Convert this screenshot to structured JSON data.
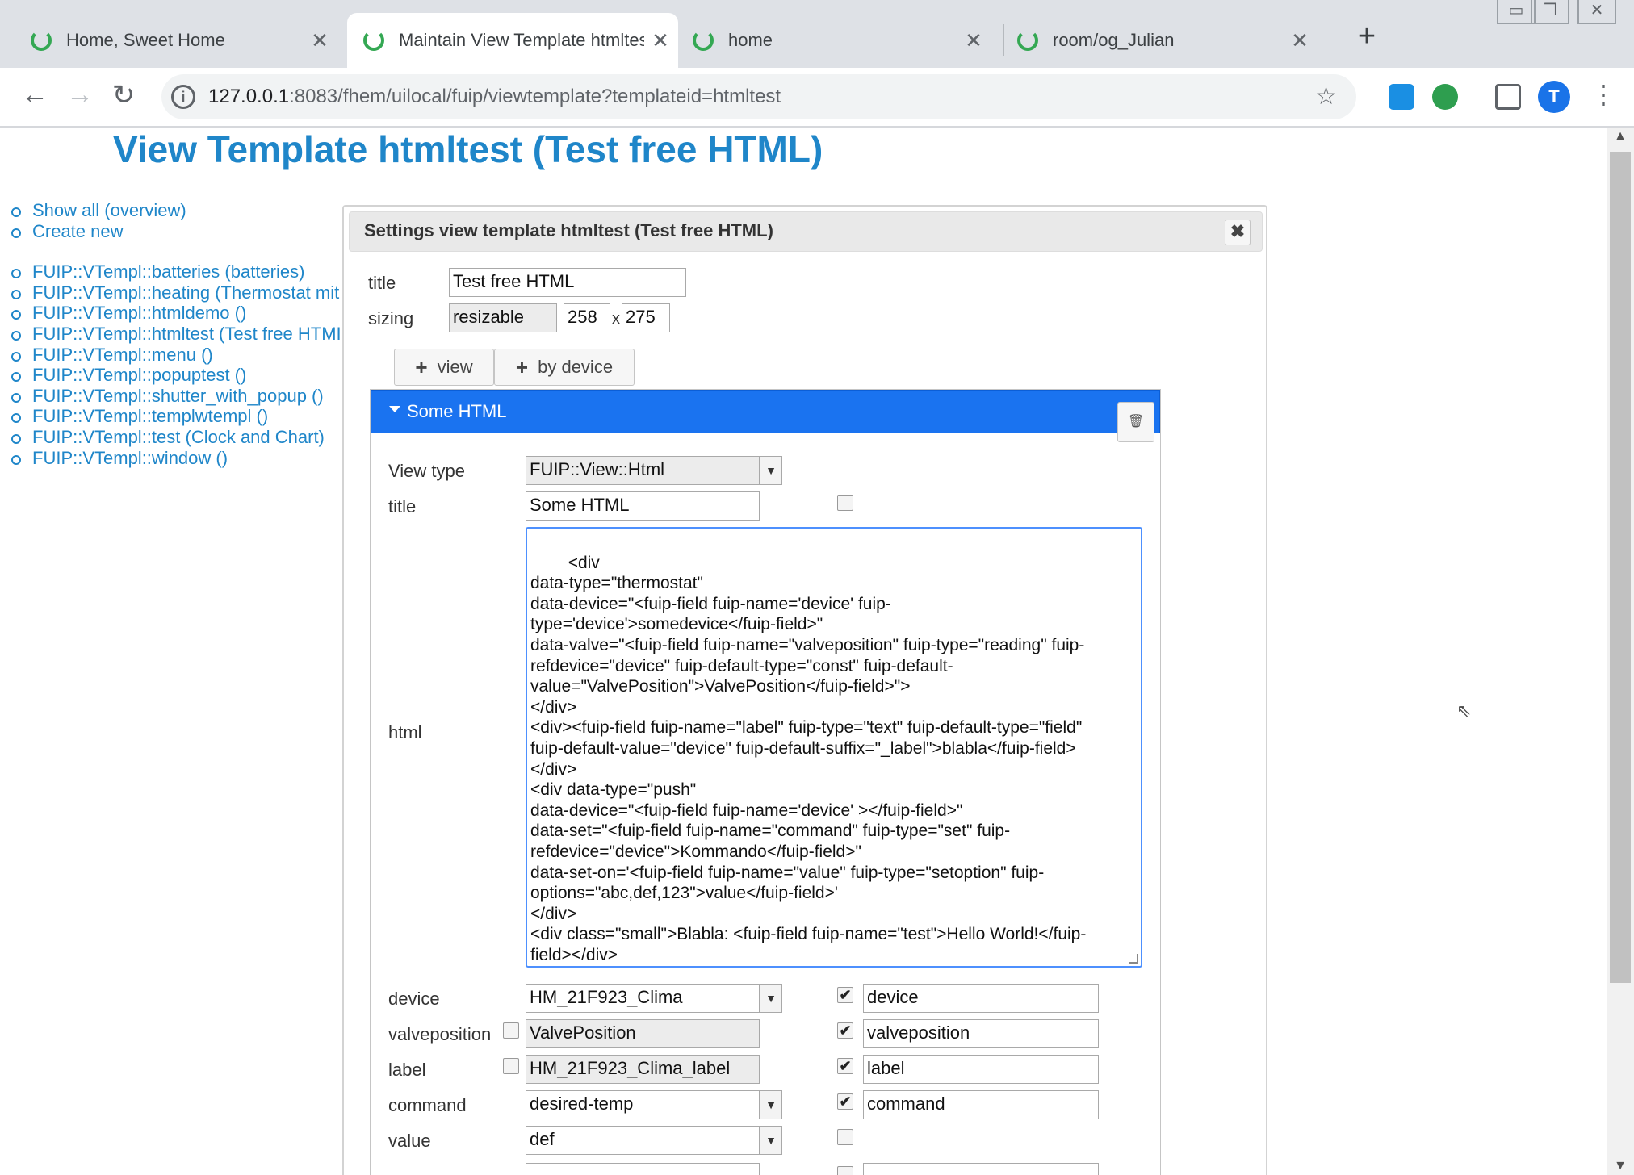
{
  "browser": {
    "tabs": [
      {
        "title": "Home, Sweet Home",
        "active": false
      },
      {
        "title": "Maintain View Template htmltest",
        "active": true
      },
      {
        "title": "home",
        "active": false
      },
      {
        "title": "room/og_Julian",
        "active": false
      }
    ],
    "new_tab": "+",
    "window_buttons": [
      "▭",
      "❐",
      "✕"
    ],
    "nav": {
      "back": "←",
      "forward": "→",
      "reload": "↻"
    },
    "url_host": "127.0.0.1",
    "url_rest": ":8083/fhem/uilocal/fuip/viewtemplate?templateid=htmltest",
    "avatar_letter": "T",
    "accent": "#1a73e8"
  },
  "page": {
    "title": "View Template htmltest (Test free HTML)",
    "nav_links": [
      "Show all (overview)",
      "Create new"
    ],
    "template_links": [
      "FUIP::VTempl::batteries (batteries)",
      "FUIP::VTempl::heating (Thermostat mit",
      "FUIP::VTempl::htmldemo ()",
      "FUIP::VTempl::htmltest (Test free HTMI",
      "FUIP::VTempl::menu ()",
      "FUIP::VTempl::popuptest ()",
      "FUIP::VTempl::shutter_with_popup ()",
      "FUIP::VTempl::templwtempl ()",
      "FUIP::VTempl::test (Clock and Chart)",
      "FUIP::VTempl::window ()"
    ]
  },
  "dialog": {
    "title": "Settings view template htmltest (Test free HTML)",
    "close_icon": "✖",
    "title_label": "title",
    "title_value": "Test free HTML",
    "sizing_label": "sizing",
    "sizing_value": "resizable",
    "width": "258",
    "x_sep": "x",
    "height": "275",
    "add_view_label": "view",
    "add_by_device_label": "by device",
    "section": {
      "title": "Some HTML",
      "view_type_label": "View type",
      "view_type_value": "FUIP::View::Html",
      "title_label": "title",
      "title_value": "Some HTML",
      "html_label": "html",
      "html_value": "<div\ndata-type=\"thermostat\"\ndata-device=\"<fuip-field fuip-name='device' fuip-\ntype='device'>somedevice</fuip-field>\"\ndata-valve=\"<fuip-field fuip-name=\"valveposition\" fuip-type=\"reading\" fuip-\nrefdevice=\"device\" fuip-default-type=\"const\" fuip-default-\nvalue=\"ValvePosition\">ValvePosition</fuip-field>\">\n</div>\n<div><fuip-field fuip-name=\"label\" fuip-type=\"text\" fuip-default-type=\"field\"\nfuip-default-value=\"device\" fuip-default-suffix=\"_label\">blabla</fuip-field>\n</div>\n<div data-type=\"push\"\ndata-device=\"<fuip-field fuip-name='device' ></fuip-field>\"\ndata-set=\"<fuip-field fuip-name=\"command\" fuip-type=\"set\" fuip-\nrefdevice=\"device\">Kommando</fuip-field>\"\ndata-set-on='<fuip-field fuip-name=\"value\" fuip-type=\"setoption\" fuip-\noptions=\"abc,def,123\">value</fuip-field>'\n</div>\n<div class=\"small\">Blabla: <fuip-field fuip-name=\"test\">Hello World!</fuip-\nfield></div>",
      "fields": [
        {
          "label": "device",
          "value": "HM_21F923_Clima",
          "has_dropdown": true,
          "left_check": null,
          "right_check": "✔",
          "param": "device"
        },
        {
          "label": "valveposition",
          "value": "ValvePosition",
          "has_dropdown": false,
          "left_check": "",
          "right_check": "✔",
          "param": "valveposition"
        },
        {
          "label": "label",
          "value": "HM_21F923_Clima_label",
          "has_dropdown": false,
          "left_check": "",
          "right_check": "✔",
          "param": "label"
        },
        {
          "label": "command",
          "value": "desired-temp",
          "has_dropdown": true,
          "left_check": null,
          "right_check": "✔",
          "param": "command"
        },
        {
          "label": "value",
          "value": "def",
          "has_dropdown": true,
          "left_check": null,
          "right_check": "",
          "param": null
        }
      ]
    }
  }
}
